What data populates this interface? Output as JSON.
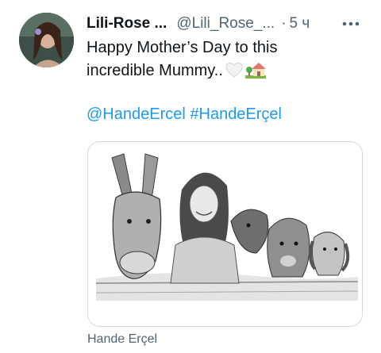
{
  "author": {
    "name": "Lili-Rose ...",
    "handle": "@Lili_Rose_...",
    "separator": "·",
    "time": "5 ч"
  },
  "tweet": {
    "text": "Happy Mother’s Day to this incredible Mummy..",
    "emojis": [
      "white-heart-icon",
      "house-with-garden-icon"
    ],
    "hashtags": [
      "@HandeErcel",
      "#HandeErçel"
    ]
  },
  "media": {
    "alt": "pencil drawing of a woman with a donkey and dogs"
  },
  "tagged_user": "Hande Erçel"
}
